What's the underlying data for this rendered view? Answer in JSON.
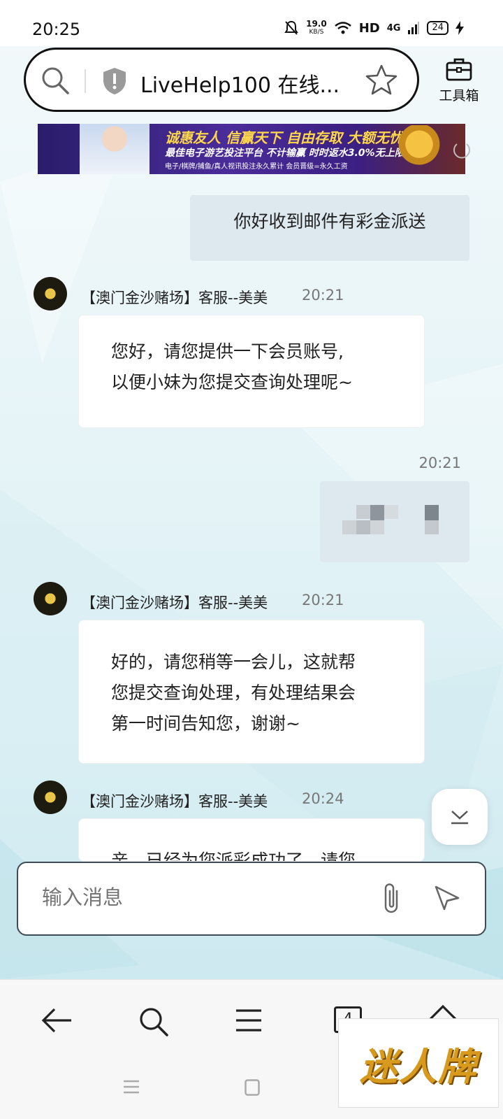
{
  "status_bar": {
    "time": "20:25",
    "net_speed": "19.0",
    "net_speed_unit": "KB/S",
    "hd_label": "HD",
    "network_label": "4G",
    "battery": "24"
  },
  "browser": {
    "page_title": "LiveHelp100 在线...",
    "toolbox_label": "工具箱"
  },
  "banner": {
    "line1": "诚惠友人 信赢天下 自由存取 大额无忧",
    "line2": "最佳电子游艺投注平台 不计输赢 时时返水3.0%无上限",
    "line3": "电子/棋牌/捕鱼/真人视讯投注永久累计 会员晋级=永久工资"
  },
  "chat": {
    "messages": [
      {
        "side": "mine",
        "text": "你好收到邮件有彩金派送"
      },
      {
        "side": "other",
        "sender": "【澳门金沙赌场】客服--美美",
        "time": "20:21",
        "lines": [
          "您好，请您提供一下会员账号,",
          "以便小妹为您提交查询处理呢~"
        ]
      },
      {
        "side": "mine",
        "time": "20:21",
        "text": ""
      },
      {
        "side": "other",
        "sender": "【澳门金沙赌场】客服--美美",
        "time": "20:21",
        "lines": [
          "好的，请您稍等一会儿，这就帮",
          "您提交查询处理，有处理结果会",
          "第一时间告知您，谢谢~"
        ]
      },
      {
        "side": "other",
        "sender": "【澳门金沙赌场】客服--美美",
        "time": "20:24",
        "lines": [
          "亲，已经为您派彩成功了，请您"
        ]
      }
    ]
  },
  "input": {
    "placeholder": "输入消息"
  },
  "bottom_nav": {
    "tabs_count": "4"
  },
  "watermark": {
    "text": "迷人牌"
  },
  "colors": {
    "my_bubble": "#dde9ef",
    "their_bubble": "#ffffff",
    "time_text": "#777777"
  }
}
